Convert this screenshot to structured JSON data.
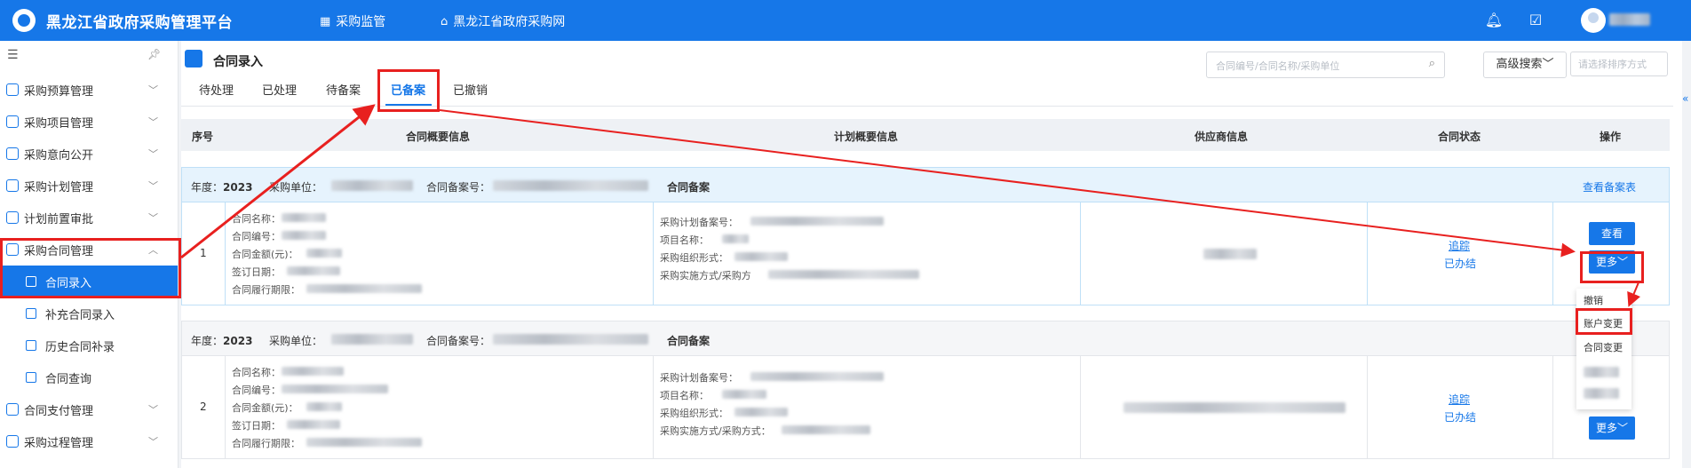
{
  "header": {
    "title": "黑龙江省政府采购管理平台",
    "nav": [
      "采购监管",
      "黑龙江省政府采购网"
    ]
  },
  "sidebar": {
    "items": [
      {
        "label": "采购预算管理"
      },
      {
        "label": "采购项目管理"
      },
      {
        "label": "采购意向公开"
      },
      {
        "label": "采购计划管理"
      },
      {
        "label": "计划前置审批"
      },
      {
        "label": "采购合同管理"
      }
    ],
    "subitems": [
      {
        "label": "合同录入"
      },
      {
        "label": "补充合同录入"
      },
      {
        "label": "历史合同补录"
      },
      {
        "label": "合同查询"
      }
    ],
    "items_after": [
      {
        "label": "合同支付管理"
      },
      {
        "label": "采购过程管理"
      }
    ]
  },
  "page": {
    "title": "合同录入",
    "tabs": [
      "待处理",
      "已处理",
      "待备案",
      "已备案",
      "已撤销"
    ],
    "search_placeholder": "合同编号/合同名称/采购单位",
    "adv_search": "高级搜索",
    "sort_placeholder": "请选择排序方式"
  },
  "table": {
    "headers": [
      "序号",
      "合同概要信息",
      "计划概要信息",
      "供应商信息",
      "合同状态",
      "操作"
    ]
  },
  "groups": [
    {
      "year_label": "年度：",
      "year": "2023",
      "unit_label": "采购单位：",
      "record_label": "合同备案号：",
      "record_type": "合同备案",
      "view_link": "查看备案表",
      "seq": "1",
      "contract_fields": [
        "合同名称：",
        "合同编号：",
        "合同金额(元)：",
        "签订日期：",
        "合同履行期限："
      ],
      "plan_fields": [
        "采购计划备案号：",
        "项目名称：",
        "采购组织形式：",
        "采购实施方式/采购方"
      ],
      "track": "追踪",
      "state": "已办结",
      "btn_view": "查看",
      "btn_more": "更多"
    },
    {
      "year_label": "年度：",
      "year": "2023",
      "unit_label": "采购单位：",
      "record_label": "合同备案号：",
      "record_type": "合同备案",
      "seq": "2",
      "contract_fields": [
        "合同名称：",
        "合同编号：",
        "合同金额(元)：",
        "签订日期：",
        "合同履行期限："
      ],
      "plan_fields": [
        "采购计划备案号：",
        "项目名称：",
        "采购组织形式：",
        "采购实施方式/采购方式："
      ],
      "track": "追踪",
      "state": "已办结",
      "btn_more": "更多"
    }
  ],
  "dropdown": {
    "items": [
      "撤销",
      "账户变更",
      "合同变更"
    ]
  },
  "colors": {
    "primary": "#1677e8",
    "highlight": "#e8201f"
  }
}
